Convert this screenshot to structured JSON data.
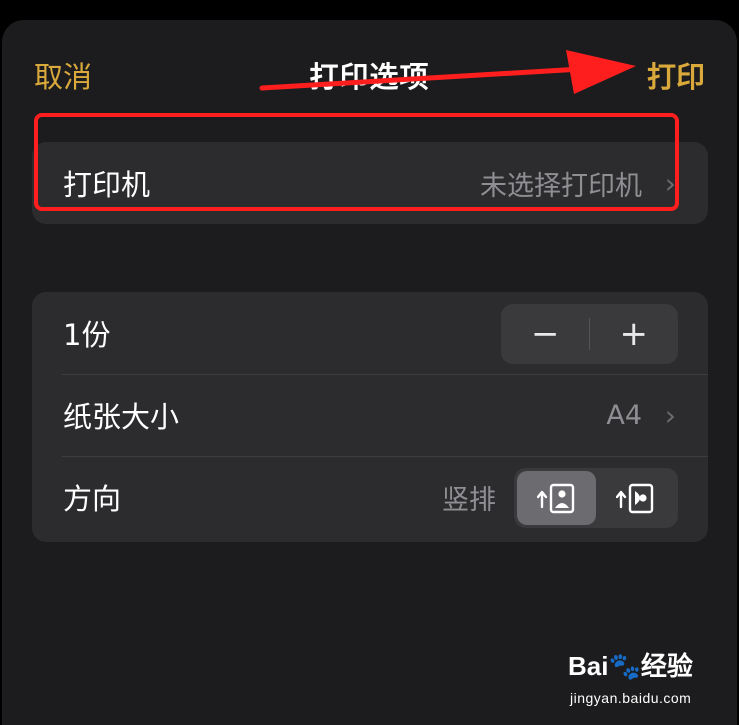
{
  "nav": {
    "cancel_label": "取消",
    "title": "打印选项",
    "print_label": "打印"
  },
  "printer_row": {
    "label": "打印机",
    "value": "未选择打印机"
  },
  "copies_row": {
    "label": "1份",
    "decrement": "−",
    "increment": "+"
  },
  "paper_row": {
    "label": "纸张大小",
    "value": "A4"
  },
  "orientation_row": {
    "label": "方向",
    "value": "竖排"
  },
  "colors": {
    "accent": "#d9a93c",
    "annotation": "#ff1e1e",
    "sheet_bg": "#1c1c1e",
    "group_bg": "#2c2c2e"
  },
  "watermark": {
    "logo": "Bai🐾经验",
    "url": "jingyan.baidu.com"
  }
}
